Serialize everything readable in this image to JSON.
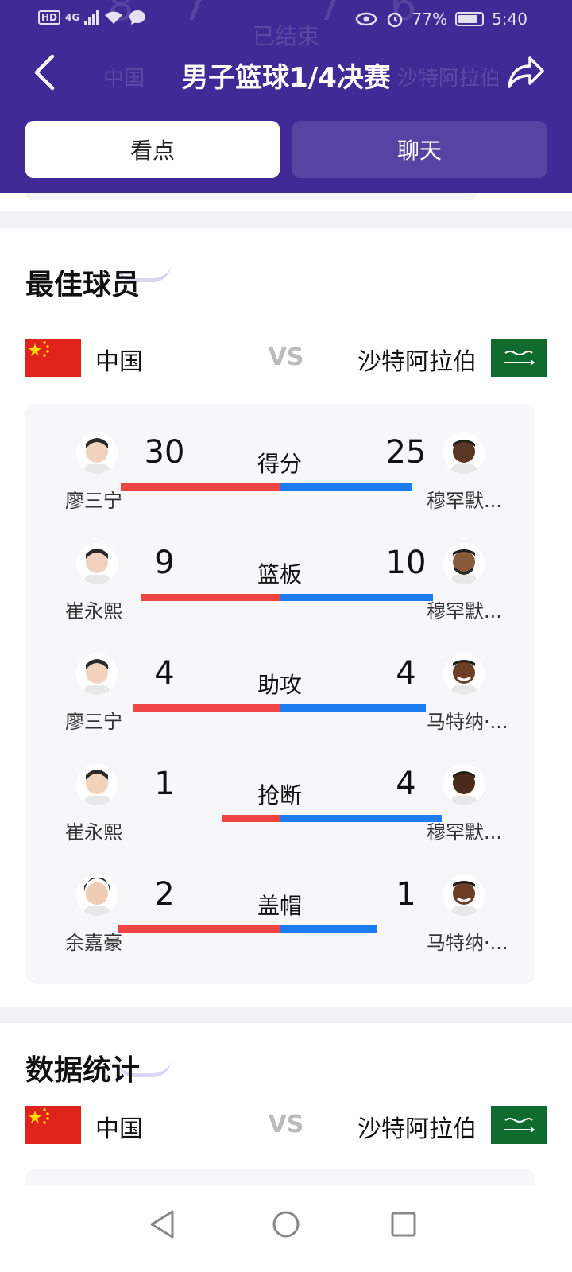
{
  "status_bar": {
    "hd": "HD",
    "network": "4G",
    "battery": "77%",
    "time": "5:40"
  },
  "ghost": {
    "status": "已结束",
    "left_team": "中国",
    "right_team": "沙特阿拉伯"
  },
  "header": {
    "title": "男子篮球1/4决赛"
  },
  "tabs": [
    {
      "label": "看点",
      "active": true
    },
    {
      "label": "聊天",
      "active": false
    }
  ],
  "best_players": {
    "title": "最佳球员",
    "team_left": "中国",
    "team_right": "沙特阿拉伯",
    "vs": "VS",
    "stats": [
      {
        "label": "得分",
        "left_player": "廖三宁",
        "left_value": "30",
        "right_player": "穆罕默...",
        "right_value": "25",
        "left_ratio": 0.545,
        "right_ratio": 0.455
      },
      {
        "label": "篮板",
        "left_player": "崔永熙",
        "left_value": "9",
        "right_player": "穆罕默...",
        "right_value": "10",
        "left_ratio": 0.474,
        "right_ratio": 0.526
      },
      {
        "label": "助攻",
        "left_player": "廖三宁",
        "left_value": "4",
        "right_player": "马特纳·...",
        "right_value": "4",
        "left_ratio": 0.5,
        "right_ratio": 0.5
      },
      {
        "label": "抢断",
        "left_player": "崔永熙",
        "left_value": "1",
        "right_player": "穆罕默...",
        "right_value": "4",
        "left_ratio": 0.2,
        "right_ratio": 0.8
      },
      {
        "label": "盖帽",
        "left_player": "余嘉豪",
        "left_value": "2",
        "right_player": "马特纳·...",
        "right_value": "1",
        "left_ratio": 0.667,
        "right_ratio": 0.333
      }
    ]
  },
  "data_stats": {
    "title": "数据统计",
    "team_left": "中国",
    "team_right": "沙特阿拉伯",
    "vs": "VS"
  },
  "colors": {
    "header_bg": "#3f2a96",
    "left_bar": "#ef4444",
    "right_bar": "#1e7cf2"
  },
  "icons": {
    "back": "chevron-left-icon",
    "share": "share-icon",
    "nav_back": "triangle-back-icon",
    "nav_home": "circle-home-icon",
    "nav_recent": "square-recent-icon"
  }
}
